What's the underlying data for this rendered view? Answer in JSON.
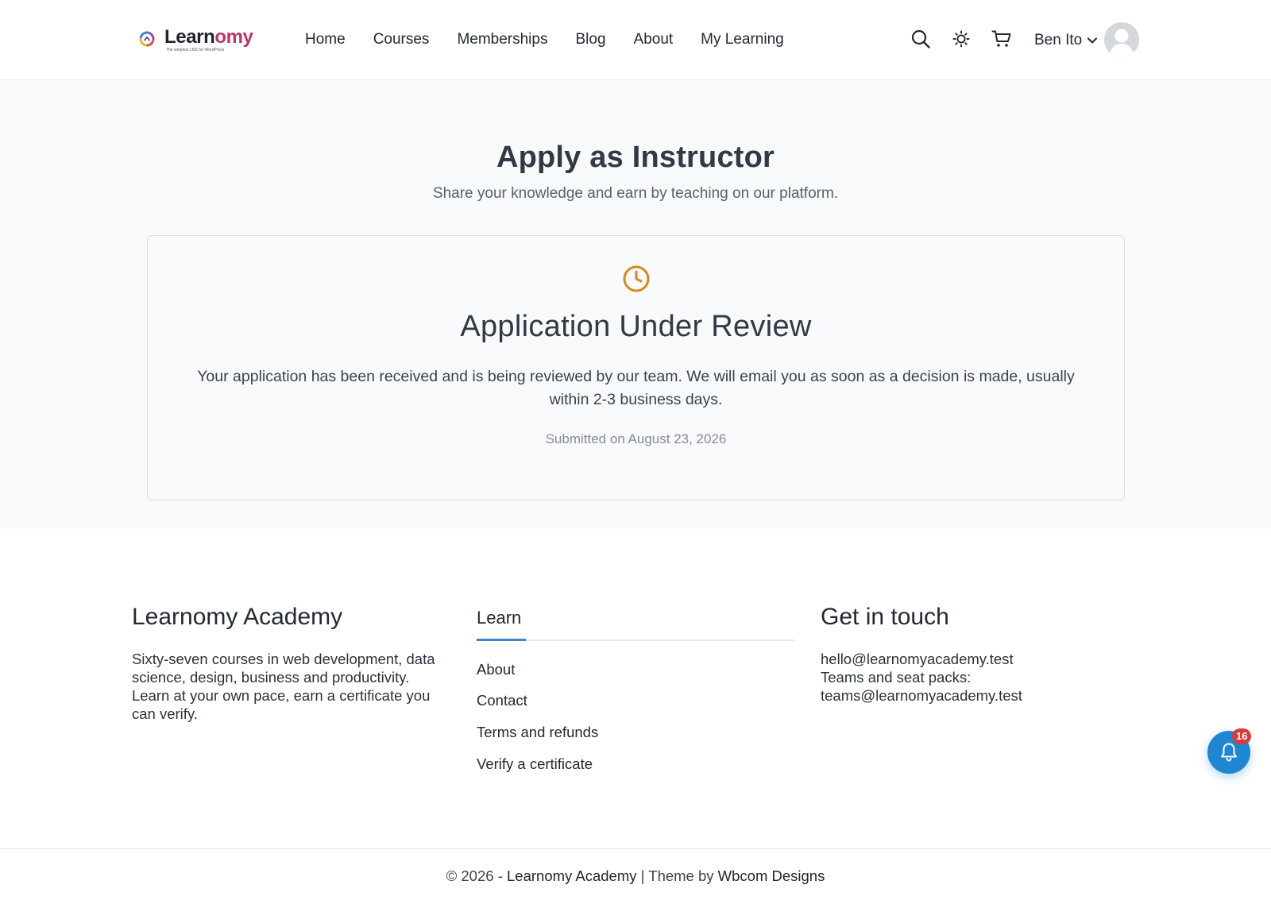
{
  "header": {
    "logo": {
      "part1": "Learn",
      "part2": "omy",
      "tagline": "The simplest LMS for WordPress"
    },
    "nav": [
      "Home",
      "Courses",
      "Memberships",
      "Blog",
      "About",
      "My Learning"
    ],
    "icons": [
      "search-icon",
      "sun-icon",
      "cart-icon"
    ],
    "user": {
      "name": "Ben Ito"
    }
  },
  "main": {
    "title": "Apply as Instructor",
    "subtitle": "Share your knowledge and earn by teaching on our platform.",
    "card": {
      "icon": "clock-icon",
      "title": "Application Under Review",
      "text": "Your application has been received and is being reviewed by our team. We will email you as soon as a decision is made, usually within 2-3 business days.",
      "submitted": "Submitted on August 23, 2026"
    }
  },
  "footer": {
    "about": {
      "title": "Learnomy Academy",
      "text": "Sixty-seven courses in web development, data science, design, business and productivity. Learn at your own pace, earn a certificate you can verify."
    },
    "learn": {
      "title": "Learn",
      "links": [
        "About",
        "Contact",
        "Terms and refunds",
        "Verify a certificate"
      ]
    },
    "contact": {
      "title": "Get in touch",
      "lines": [
        "hello@learnomyacademy.test",
        "Teams and seat packs:",
        "teams@learnomyacademy.test"
      ]
    },
    "copyright": {
      "prefix": "© 2026 - ",
      "site": "Learnomy Academy",
      "separator": " | Theme by ",
      "theme_author": "Wbcom Designs"
    }
  },
  "notifications": {
    "count": "16"
  },
  "colors": {
    "accent": "#1f86d1",
    "badge": "#d63c3c",
    "clock": "#d48a1f",
    "brand": "#b8356e"
  }
}
